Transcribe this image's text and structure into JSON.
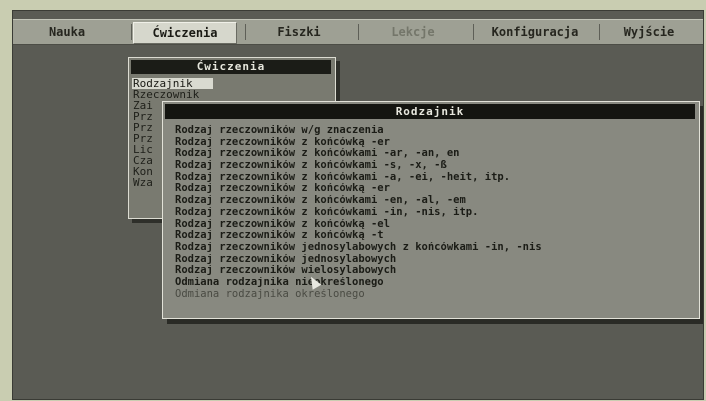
{
  "menubar": {
    "items": [
      {
        "label": "Nauka",
        "state": "normal"
      },
      {
        "label": "Ćwiczenia",
        "state": "active"
      },
      {
        "label": "Fiszki",
        "state": "normal"
      },
      {
        "label": "Lekcje",
        "state": "disabled"
      },
      {
        "label": "Konfiguracja",
        "state": "normal"
      },
      {
        "label": "Wyjście",
        "state": "normal"
      }
    ]
  },
  "cwiczenia_menu": {
    "title": "Ćwiczenia",
    "items": [
      "Rodzajnik",
      "Rzeczownik",
      "Zai",
      "Prz",
      "Prz",
      "Prz",
      "Lic",
      "Cza",
      "Kon",
      "Wza"
    ]
  },
  "rodzajnik_menu": {
    "title": "Rodzajnik",
    "items": [
      {
        "label": "Rodzaj rzeczowników w/g znaczenia",
        "dim": false
      },
      {
        "label": "Rodzaj rzeczowników z końcówką -er",
        "dim": false
      },
      {
        "label": "Rodzaj rzeczowników z końcówkami -ar, -an, en",
        "dim": false
      },
      {
        "label": "Rodzaj rzeczowników z końcówkami -s, -x, -ß",
        "dim": false
      },
      {
        "label": "Rodzaj rzeczowników z końcówkami -a, -ei, -heit, itp.",
        "dim": false
      },
      {
        "label": "Rodzaj rzeczowników z końcówką -er",
        "dim": false
      },
      {
        "label": "Rodzaj rzeczowników z końcówkami -en, -al, -em",
        "dim": false
      },
      {
        "label": "Rodzaj rzeczowników z końcówkami -in, -nis, itp.",
        "dim": false
      },
      {
        "label": "Rodzaj rzeczowników z końcówką -el",
        "dim": false
      },
      {
        "label": "Rodzaj rzeczowników z końcówką -t",
        "dim": false
      },
      {
        "label": "Rodzaj rzeczowników jednosylabowych z końcówkami -in, -nis",
        "dim": false
      },
      {
        "label": "Rodzaj rzeczowników jednosylabowych",
        "dim": false
      },
      {
        "label": "Rodzaj rzeczowników wielosylabowych",
        "dim": false
      },
      {
        "label": "Odmiana rodzajnika nieokreślonego",
        "dim": false
      },
      {
        "label": "Odmiana rodzajnika określonego",
        "dim": true
      }
    ]
  },
  "colors": {
    "screen_background": "#5a5b54",
    "menubar_background": "#9ea094",
    "title_bar": "#141510",
    "menu_background": "#888980"
  }
}
